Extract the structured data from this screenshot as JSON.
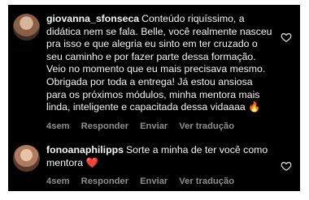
{
  "comments": [
    {
      "username": "giovanna_sfonseca",
      "text": "Conteúdo riquíssimo, a didática nem se fala. Belle, você realmente nasceu pra isso e que alegria eu sinto em ter cruzado o seu caminho e por fazer parte dessa formação. Veio no momento que eu mais precisava mesmo. Obrigada por toda a entrega! Já estou ansiosa para os próximos módulos, minha mentora mais linda, inteligente e capacitada dessa vidaaaa 🔥",
      "time": "4sem",
      "reply": "Responder",
      "send": "Enviar",
      "translate": "Ver tradução"
    },
    {
      "username": "fonoanaphilipps",
      "text": "Sorte a minha de ter você como mentora ❤️",
      "time": "4sem",
      "reply": "Responder",
      "send": "Enviar",
      "translate": "Ver tradução"
    }
  ],
  "icons": {
    "like": "heart-outline-icon",
    "avatar": "profile-photo"
  },
  "colors": {
    "background": "#000000",
    "text": "#f5f5f5",
    "meta": "#8e8e8e"
  }
}
